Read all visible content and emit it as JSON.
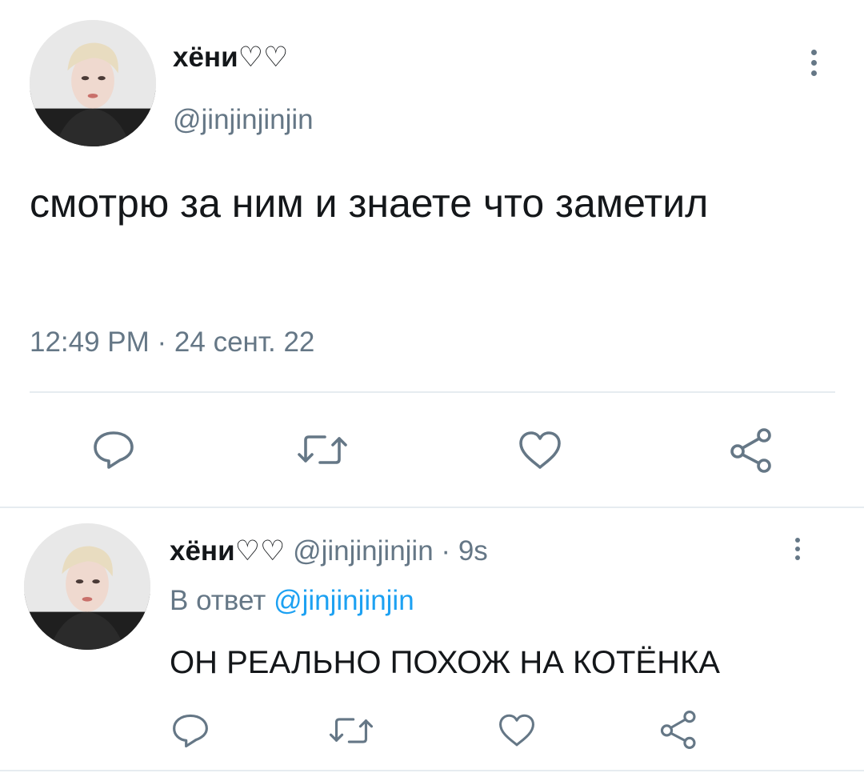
{
  "main_tweet": {
    "display_name": "хёни♡♡",
    "handle": "@jinjinjinjin",
    "text": "смотрю за ним и знаете что заметил",
    "timestamp": "12:49 PM · 24 сент. 22",
    "actions": [
      "reply-icon",
      "retweet-icon",
      "like-icon",
      "share-icon"
    ]
  },
  "reply": {
    "display_name": "хёни♡♡",
    "handle": "@jinjinjinjin",
    "separator": "·",
    "age": "9s",
    "reply_prefix": "В ответ",
    "reply_to": "@jinjinjinjin",
    "text": "ОН РЕАЛЬНО ПОХОЖ НА КОТЁНКА",
    "actions": [
      "reply-icon",
      "retweet-icon",
      "like-icon",
      "share-icon"
    ]
  },
  "colors": {
    "text": "#14171a",
    "muted": "#657786",
    "accent": "#1da1f2",
    "divider": "#e6ecf0"
  }
}
